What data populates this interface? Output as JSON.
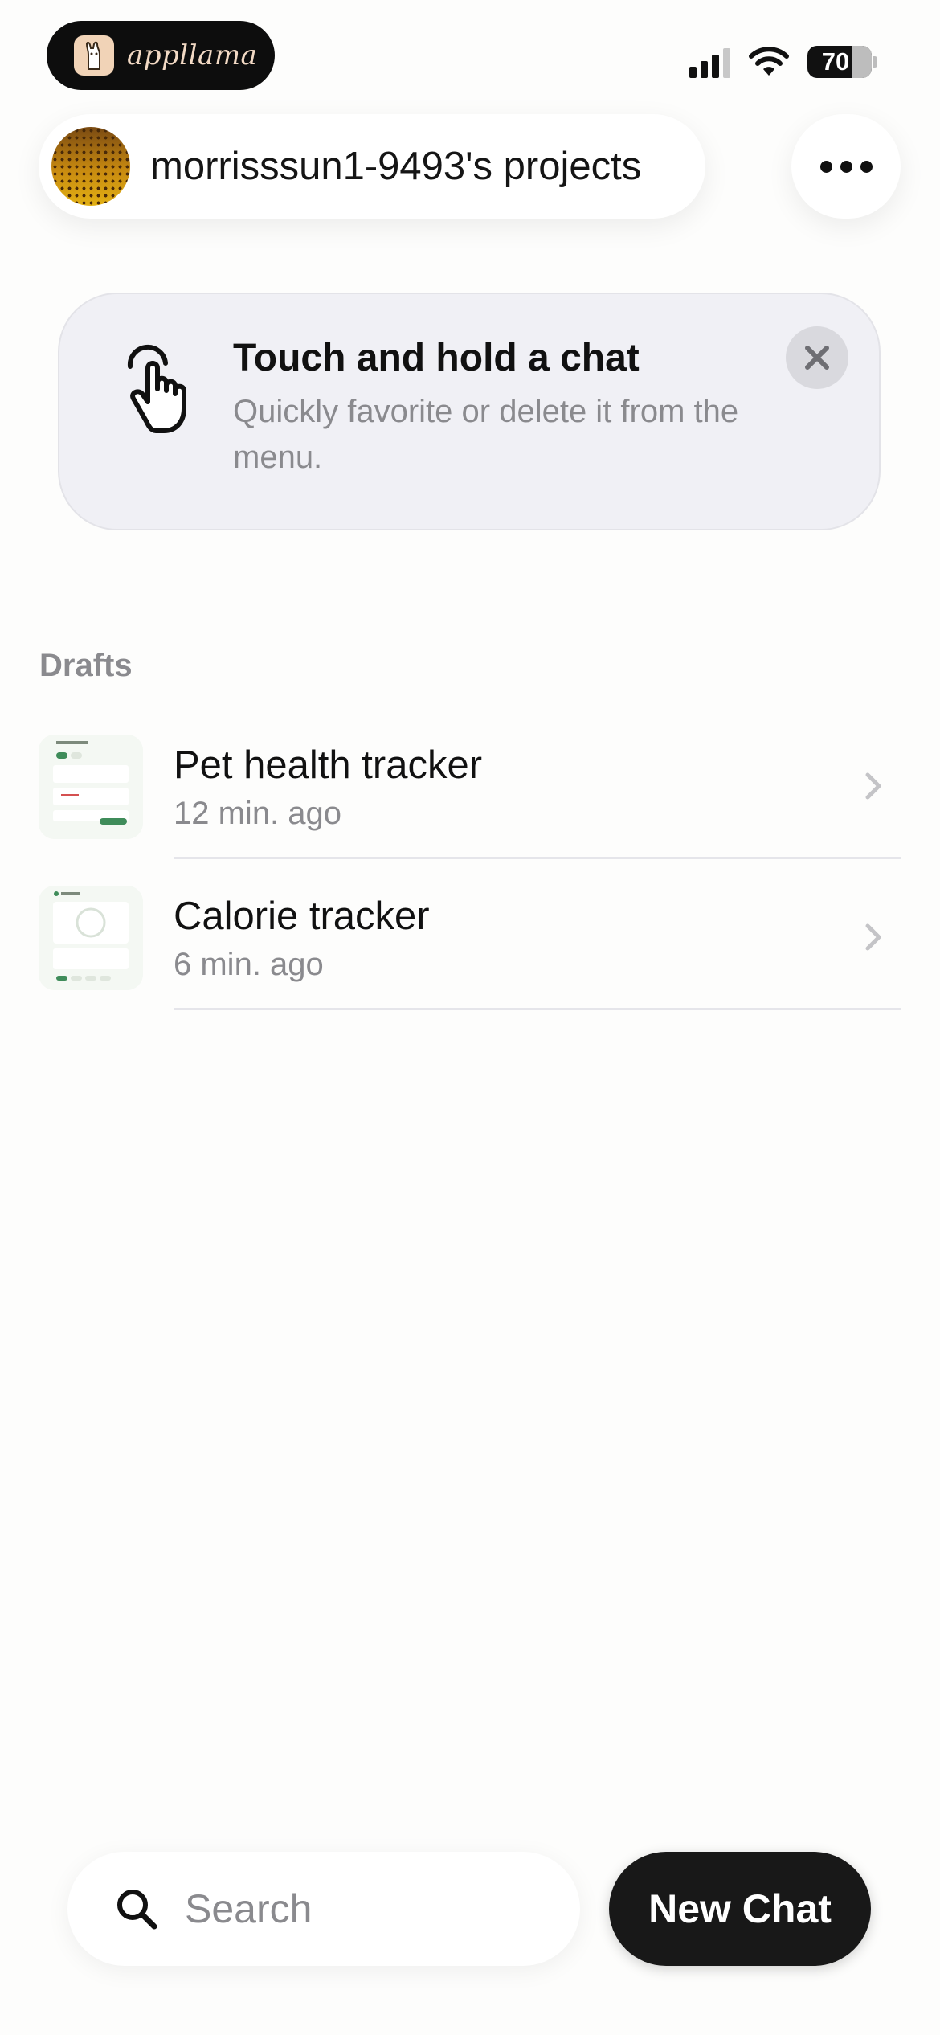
{
  "status_bar": {
    "app_name": "appllama",
    "battery": "70",
    "icons": [
      "signal-icon",
      "wifi-icon",
      "battery-icon"
    ]
  },
  "header": {
    "project_name": "morrisssun1-9493's projects",
    "more_icon": "ellipsis-icon"
  },
  "tip": {
    "title": "Touch and hold a chat",
    "body": "Quickly favorite or delete it from the menu.",
    "icon": "tap-hand-icon"
  },
  "drafts": {
    "label": "Drafts",
    "items": [
      {
        "title": "Pet health tracker",
        "time": "12 min. ago"
      },
      {
        "title": "Calorie tracker",
        "time": "6 min. ago"
      }
    ]
  },
  "bottom": {
    "search_placeholder": "Search",
    "new_chat_label": "New Chat"
  },
  "colors": {
    "background": "#fdfdfc",
    "tip_card": "#f0f0f5",
    "secondary_text": "#8a8a8e",
    "primary_button": "#181818"
  }
}
